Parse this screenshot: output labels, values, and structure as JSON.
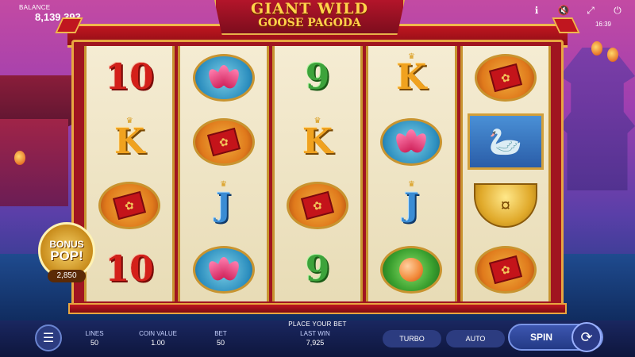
{
  "header": {
    "balance_label": "BALANCE",
    "balance_value": "8,139,393",
    "clock": "16:39",
    "icons": [
      "info-icon",
      "sound-off-icon",
      "fullscreen-icon",
      "power-icon"
    ]
  },
  "title": {
    "line1": "GIANT WILD",
    "line2": "GOOSE PAGODA"
  },
  "reels": [
    [
      "10",
      "K",
      "envelope",
      "10"
    ],
    [
      "lotus",
      "envelope",
      "J",
      "lotus"
    ],
    [
      "9",
      "K",
      "envelope",
      "9"
    ],
    [
      "K",
      "lotus",
      "J",
      "peach"
    ],
    [
      "envelope",
      "goose",
      "gold",
      "envelope"
    ]
  ],
  "bonus": {
    "word1": "BONUS",
    "word2": "POP!",
    "value": "2,850"
  },
  "footer": {
    "message": "PLACE YOUR BET",
    "lines_label": "LINES",
    "lines_value": "50",
    "coin_label": "COIN VALUE",
    "coin_value": "1.00",
    "bet_label": "BET",
    "bet_value": "50",
    "lastwin_label": "LAST WIN",
    "lastwin_value": "7,925",
    "turbo": "TURBO",
    "auto": "AUTO",
    "spin": "SPIN"
  }
}
